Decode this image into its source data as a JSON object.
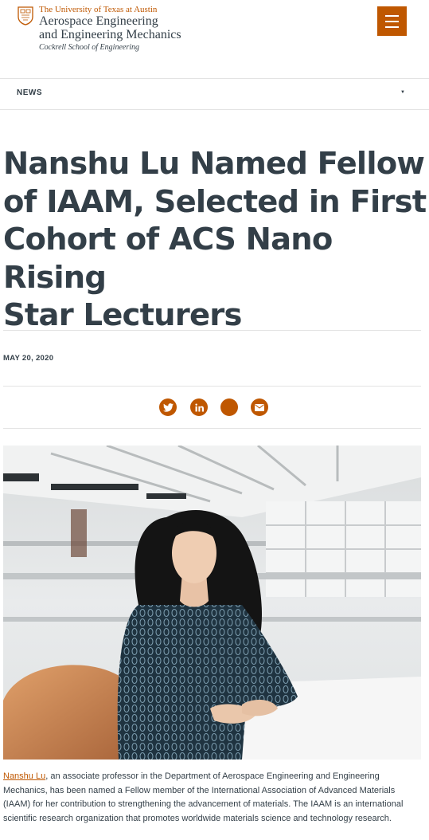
{
  "header": {
    "university": "The University of Texas at Austin",
    "department_line1": "Aerospace Engineering",
    "department_line2": "and Engineering Mechanics",
    "school": "Cockrell School of Engineering",
    "menu_icon": "hamburger-menu-icon"
  },
  "nav": {
    "news_label": "NEWS",
    "dropdown_icon": "caret-down-icon"
  },
  "article": {
    "headline_line1": "Nanshu Lu Named Fellow",
    "headline_line2": "of IAAM, Selected in First",
    "headline_line3": "Cohort of ACS Nano Rising",
    "headline_line4": "Star Lecturers",
    "date": "MAY 20, 2020",
    "share_icons": [
      "twitter-icon",
      "linkedin-icon",
      "share-icon",
      "email-icon"
    ],
    "photo_alt": "Nanshu Lu",
    "person_link": "Nanshu Lu",
    "body_text": ", an associate professor in the Department of Aerospace Engineering and Engineering Mechanics, has been named a Fellow member of the International Association of Advanced Materials (IAAM) for her contribution to strengthening the advancement of materials. The IAAM is an international scientific research organization that promotes worldwide materials science and technology research."
  },
  "colors": {
    "accent": "#bf5700",
    "text": "#333f48",
    "divider": "#e3e3e3"
  }
}
